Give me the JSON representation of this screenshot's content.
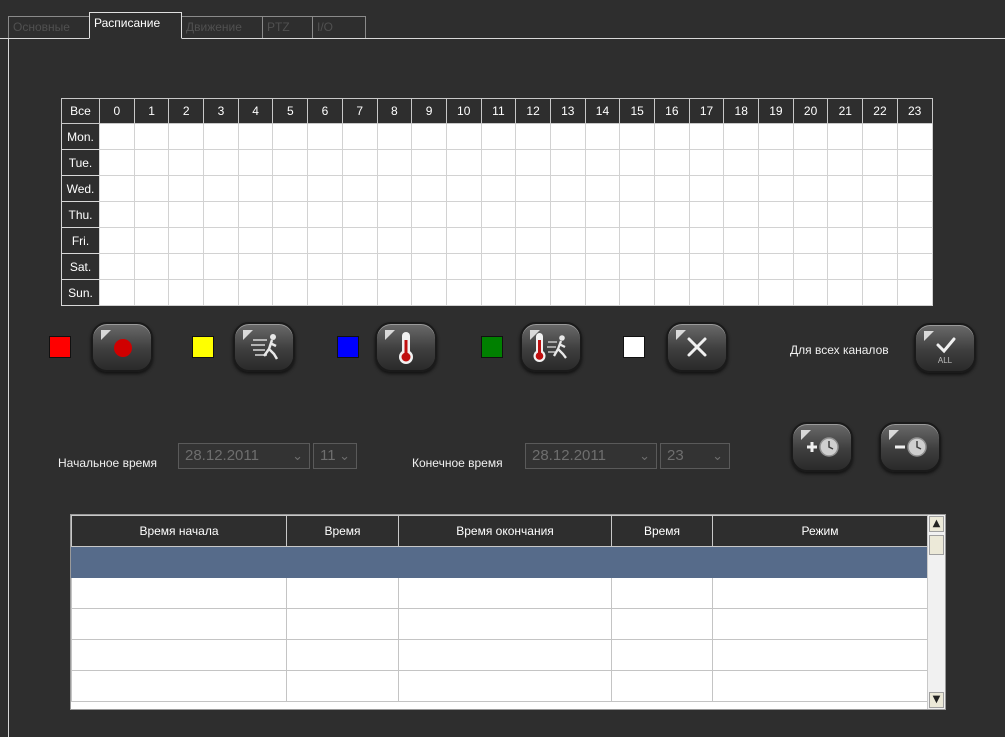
{
  "tabs": [
    {
      "label": "Основные",
      "active": false
    },
    {
      "label": "Расписание",
      "active": true
    },
    {
      "label": "Движение",
      "active": false
    },
    {
      "label": "PTZ",
      "active": false
    },
    {
      "label": "I/O",
      "active": false
    }
  ],
  "schedule": {
    "corner_label": "Все",
    "hours": [
      "0",
      "1",
      "2",
      "3",
      "4",
      "5",
      "6",
      "7",
      "8",
      "9",
      "10",
      "11",
      "12",
      "13",
      "14",
      "15",
      "16",
      "17",
      "18",
      "19",
      "20",
      "21",
      "22",
      "23"
    ],
    "days": [
      "Mon.",
      "Tue.",
      "Wed.",
      "Thu.",
      "Fri.",
      "Sat.",
      "Sun."
    ]
  },
  "legend": [
    {
      "color": "#ff0000",
      "icon": "record-icon"
    },
    {
      "color": "#ffff00",
      "icon": "motion-icon"
    },
    {
      "color": "#0000ff",
      "icon": "thermometer-icon"
    },
    {
      "color": "#008000",
      "icon": "thermometer-motion-icon"
    },
    {
      "color": "#ffffff",
      "icon": "clear-icon"
    }
  ],
  "all_channels": {
    "label": "Для всех каналов",
    "icon": "apply-all-icon",
    "icon_text": "ALL"
  },
  "time": {
    "start_label": "Начальное время",
    "start_date": "28.12.2011",
    "start_hour": "11",
    "end_label": "Конечное время",
    "end_date": "28.12.2011",
    "end_hour": "23"
  },
  "list": {
    "columns": [
      "Время начала",
      "Время",
      "Время окончания",
      "Время",
      "Режим"
    ],
    "rows": [
      {
        "selected": true
      },
      {
        "selected": false
      },
      {
        "selected": false
      },
      {
        "selected": false
      },
      {
        "selected": false
      }
    ]
  }
}
